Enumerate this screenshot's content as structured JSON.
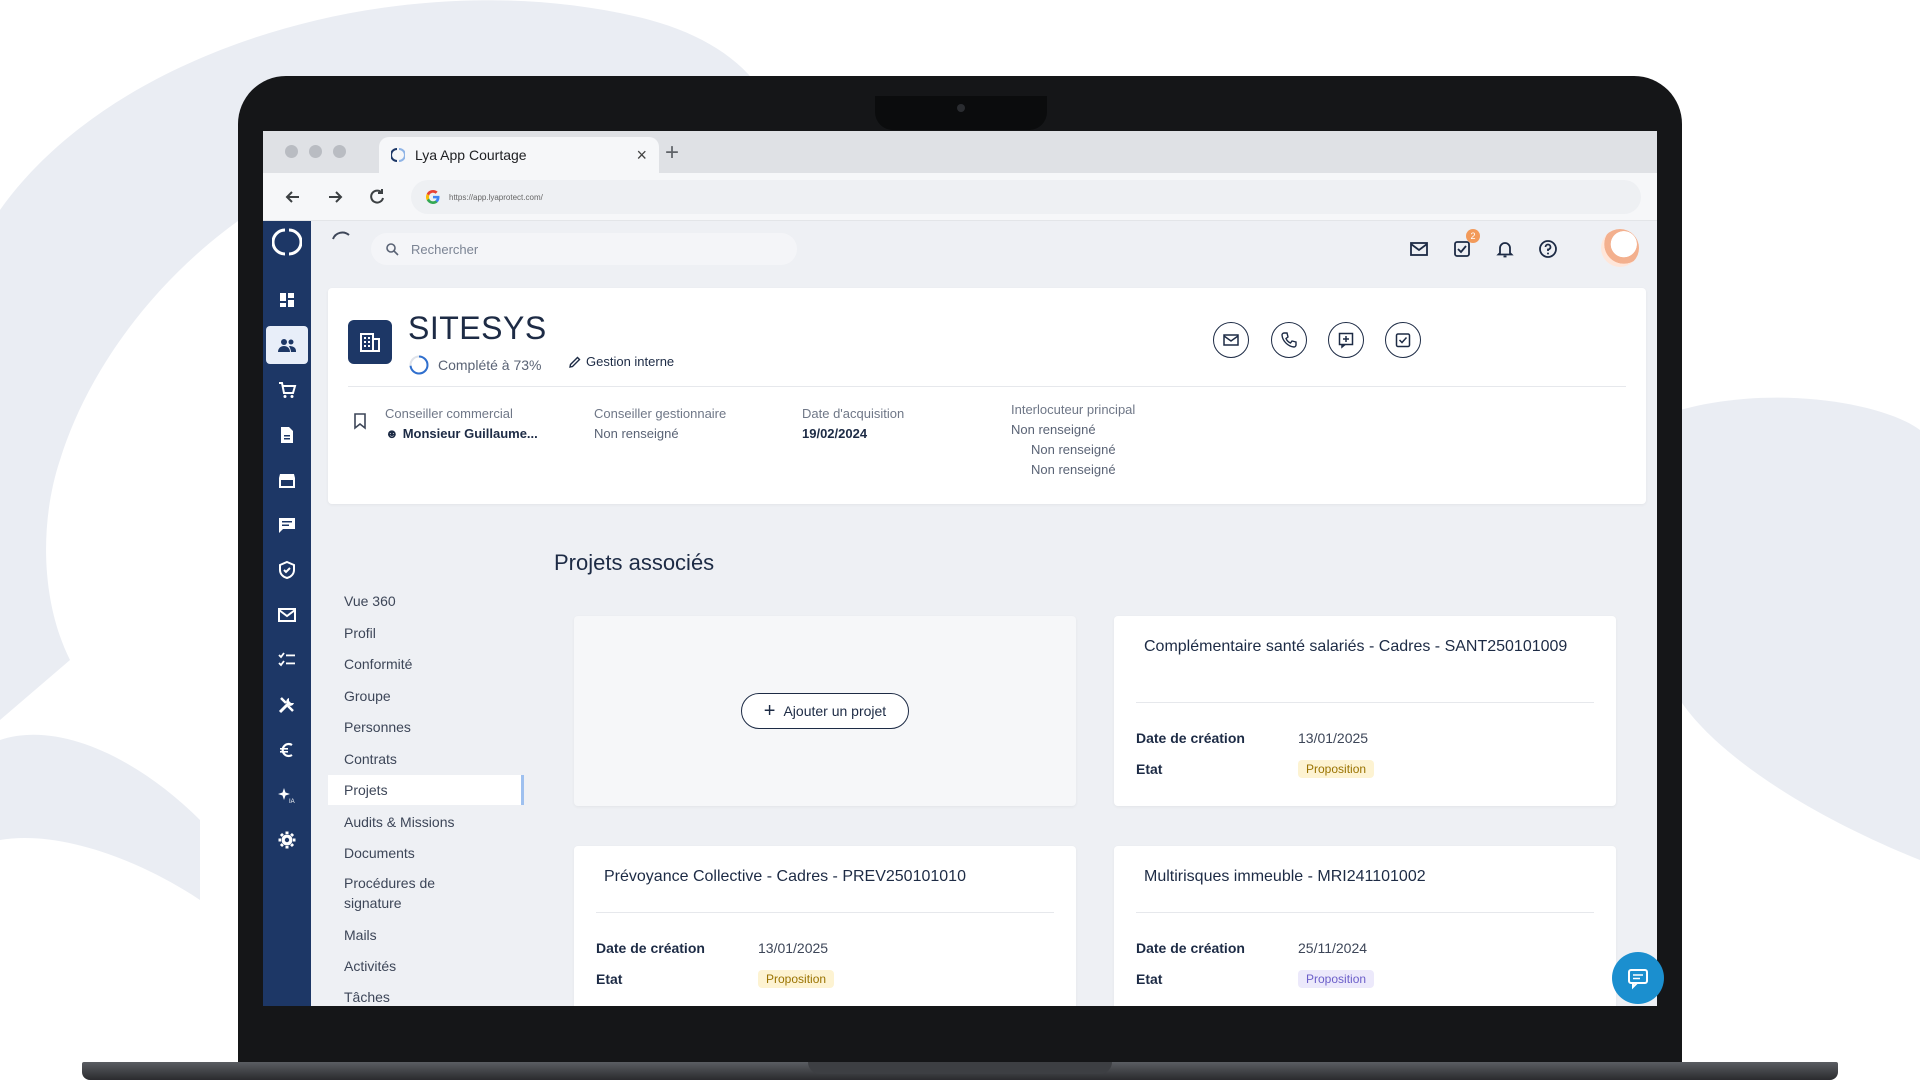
{
  "browser": {
    "tab_title": "Lya App Courtage",
    "url": "https://app.lyaprotect.com/"
  },
  "topbar": {
    "search_placeholder": "Rechercher",
    "tasks_badge": "2"
  },
  "company": {
    "name": "SITESYS",
    "completion": "Complété à 73%",
    "completion_value": 0.73,
    "gestion_label": "Gestion interne"
  },
  "info": {
    "commercial_label": "Conseiller commercial",
    "commercial_value": "Monsieur Guillaume...",
    "gestionnaire_label": "Conseiller gestionnaire",
    "gestionnaire_value": "Non renseigné",
    "acquisition_label": "Date d'acquisition",
    "acquisition_value": "19/02/2024",
    "interlocuteur_label": "Interlocuteur principal",
    "interlocuteur_lines": [
      "Non renseigné",
      "Non renseigné",
      "Non renseigné"
    ]
  },
  "submenu": {
    "items": [
      "Vue 360",
      "Profil",
      "Conformité",
      "Groupe",
      "Personnes",
      "Contrats",
      "Projets",
      "Audits & Missions",
      "Documents",
      "Procédures de signature",
      "Mails",
      "Activités",
      "Tâches"
    ],
    "active": "Projets"
  },
  "content": {
    "title": "Projets associés",
    "add_label": "Ajouter un projet",
    "creation_label": "Date de création",
    "etat_label": "Etat",
    "projects": [
      {
        "title": "Complémentaire santé salariés - Cadres - SANT250101009",
        "date": "13/01/2025",
        "etat": "Proposition"
      },
      {
        "title": "Prévoyance Collective - Cadres - PREV250101010",
        "date": "13/01/2025",
        "etat": "Proposition"
      },
      {
        "title": "Multirisques immeuble - MRI241101002",
        "date": "25/11/2024",
        "etat": "Proposition"
      }
    ]
  },
  "colors": {
    "brand_navy": "#1d3766",
    "accent_badge": "#f29a5a",
    "chat": "#1b8fcf"
  }
}
